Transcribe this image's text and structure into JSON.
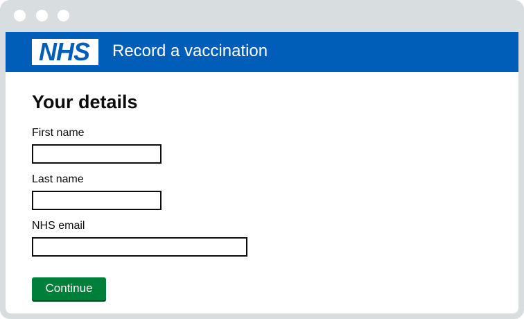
{
  "header": {
    "logo_text": "NHS",
    "service_name": "Record a vaccination"
  },
  "main": {
    "title": "Your details",
    "fields": [
      {
        "label": "First name",
        "value": ""
      },
      {
        "label": "Last name",
        "value": ""
      },
      {
        "label": "NHS email",
        "value": ""
      }
    ],
    "continue_label": "Continue"
  },
  "colors": {
    "nhs_blue": "#005eb8",
    "button_green": "#007f3b",
    "button_shadow": "#00401e",
    "text": "#0b0c0c",
    "window_frame": "#d8dde0"
  },
  "icons": {
    "window_controls": [
      "window-dot-icon",
      "window-dot-icon",
      "window-dot-icon"
    ]
  }
}
